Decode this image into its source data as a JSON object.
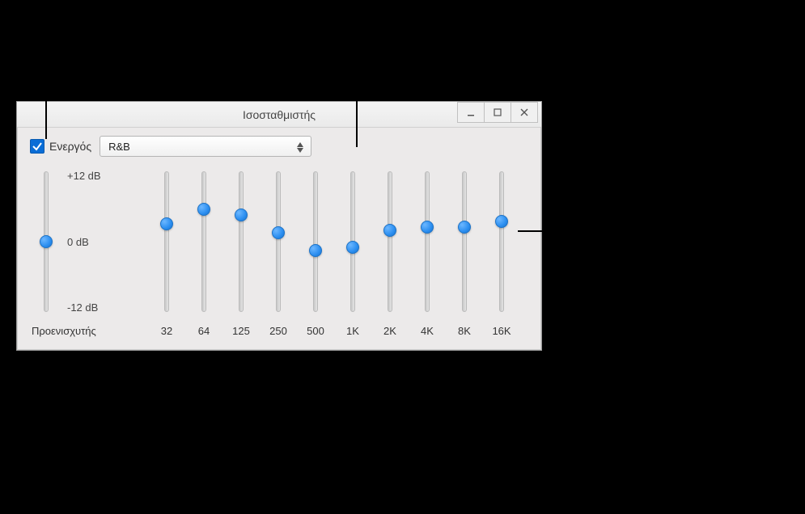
{
  "window": {
    "title": "Ισοσταθμιστής"
  },
  "enable": {
    "label": "Ενεργός",
    "checked": true
  },
  "preset": {
    "selected": "R&B"
  },
  "preamp": {
    "label": "Προενισχυτής",
    "value_db": 0
  },
  "db_scale": {
    "top": "+12 dB",
    "mid": "0 dB",
    "bottom": "-12 dB"
  },
  "bands": [
    {
      "freq": "32",
      "value_db": 3.0
    },
    {
      "freq": "64",
      "value_db": 5.5
    },
    {
      "freq": "125",
      "value_db": 4.5
    },
    {
      "freq": "250",
      "value_db": 1.5
    },
    {
      "freq": "500",
      "value_db": -1.5
    },
    {
      "freq": "1K",
      "value_db": -1.0
    },
    {
      "freq": "2K",
      "value_db": 2.0
    },
    {
      "freq": "4K",
      "value_db": 2.5
    },
    {
      "freq": "8K",
      "value_db": 2.5
    },
    {
      "freq": "16K",
      "value_db": 3.5
    }
  ]
}
